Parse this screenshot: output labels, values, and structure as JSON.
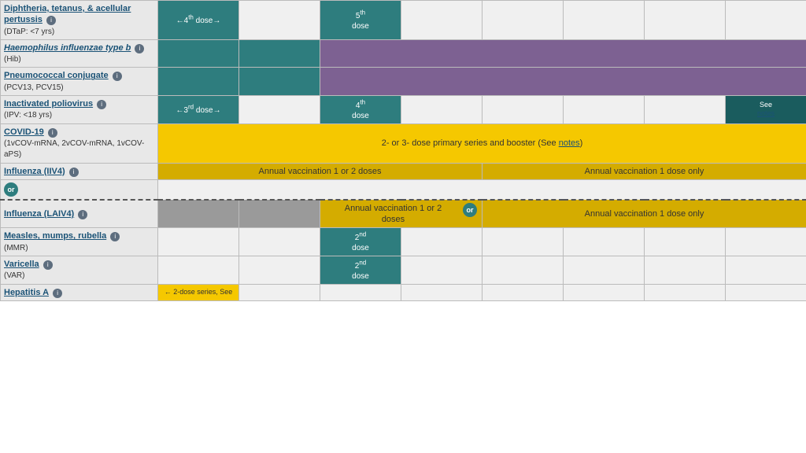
{
  "vaccines": [
    {
      "id": "dtap",
      "name": "Diphtheria, tetanus, & acellular pertussis",
      "italic": false,
      "subLabel": "(DTaP: <7 yrs)",
      "hasInfo": true,
      "row": [
        {
          "colspan": 1,
          "class": "teal-dark",
          "text": "←4th dose→",
          "sup": ""
        },
        {
          "colspan": 1,
          "class": "empty-cell",
          "text": ""
        },
        {
          "colspan": 1,
          "class": "teal-dark",
          "text": "5th\ndose",
          "sup": ""
        },
        {
          "colspan": 1,
          "class": "empty-cell",
          "text": ""
        },
        {
          "colspan": 1,
          "class": "empty-cell",
          "text": ""
        },
        {
          "colspan": 1,
          "class": "empty-cell",
          "text": ""
        },
        {
          "colspan": 1,
          "class": "empty-cell",
          "text": ""
        },
        {
          "colspan": 1,
          "class": "empty-cell",
          "text": ""
        }
      ]
    },
    {
      "id": "hib",
      "name": "Haemophilus influenzae type b",
      "italic": true,
      "subLabel": "(Hib)",
      "hasInfo": true,
      "row": [
        {
          "colspan": 1,
          "class": "teal-dark",
          "text": ""
        },
        {
          "colspan": 1,
          "class": "teal-dark",
          "text": ""
        },
        {
          "colspan": 6,
          "class": "purple",
          "text": ""
        }
      ]
    },
    {
      "id": "pcv",
      "name": "Pneumococcal conjugate",
      "italic": false,
      "subLabel": "(PCV13, PCV15)",
      "hasInfo": true,
      "row": [
        {
          "colspan": 1,
          "class": "teal-dark",
          "text": ""
        },
        {
          "colspan": 1,
          "class": "teal-dark",
          "text": ""
        },
        {
          "colspan": 6,
          "class": "purple",
          "text": ""
        }
      ]
    },
    {
      "id": "ipv",
      "name": "Inactivated poliovirus",
      "italic": false,
      "subLabel": "(IPV: <18 yrs)",
      "hasInfo": true,
      "row": [
        {
          "colspan": 1,
          "class": "teal-dark",
          "text": "←3rd dose→"
        },
        {
          "colspan": 1,
          "class": "empty-cell",
          "text": ""
        },
        {
          "colspan": 1,
          "class": "teal-dark",
          "text": "4th\ndose"
        },
        {
          "colspan": 1,
          "class": "empty-cell",
          "text": ""
        },
        {
          "colspan": 1,
          "class": "empty-cell",
          "text": ""
        },
        {
          "colspan": 1,
          "class": "empty-cell",
          "text": ""
        },
        {
          "colspan": 1,
          "class": "empty-cell",
          "text": ""
        },
        {
          "colspan": 1,
          "class": "dark-teal",
          "text": "See\nnotes",
          "link": true
        }
      ]
    },
    {
      "id": "covid",
      "name": "COVID-19",
      "italic": false,
      "subLabel": "(1vCOV-mRNA, 2vCOV-mRNA, 1vCOV-aPS)",
      "hasInfo": true,
      "row": [
        {
          "colspan": 8,
          "class": "yellow",
          "text": "2- or 3- dose primary series and booster (See notes)",
          "hasNotesLink": true
        }
      ]
    },
    {
      "id": "influenza-iiv4",
      "name": "Influenza (IIV4)",
      "italic": false,
      "subLabel": "",
      "hasInfo": true,
      "row": [
        {
          "colspan": 4,
          "class": "yellow-dark",
          "text": "Annual vaccination 1 or 2 doses"
        },
        {
          "colspan": 4,
          "class": "yellow-dark",
          "text": "Annual vaccination 1 dose only"
        }
      ]
    },
    {
      "id": "or-row",
      "isOrRow": true
    },
    {
      "id": "influenza-laiv4",
      "name": "Influenza (LAIV4)",
      "italic": false,
      "subLabel": "",
      "hasInfo": true,
      "isDashed": true,
      "row": [
        {
          "colspan": 1,
          "class": "gray-cell",
          "text": ""
        },
        {
          "colspan": 1,
          "class": "gray-cell",
          "text": ""
        },
        {
          "colspan": 2,
          "class": "yellow-dark",
          "text": "Annual vaccination 1 or 2 doses",
          "hasOrBadge": true
        },
        {
          "colspan": 4,
          "class": "yellow-dark",
          "text": "Annual vaccination 1 dose only"
        }
      ]
    },
    {
      "id": "mmr",
      "name": "Measles, mumps, rubella",
      "italic": false,
      "subLabel": "(MMR)",
      "hasInfo": true,
      "row": [
        {
          "colspan": 1,
          "class": "empty-cell",
          "text": ""
        },
        {
          "colspan": 1,
          "class": "empty-cell",
          "text": ""
        },
        {
          "colspan": 1,
          "class": "teal-dark",
          "text": "2nd\ndose"
        },
        {
          "colspan": 1,
          "class": "empty-cell",
          "text": ""
        },
        {
          "colspan": 1,
          "class": "empty-cell",
          "text": ""
        },
        {
          "colspan": 1,
          "class": "empty-cell",
          "text": ""
        },
        {
          "colspan": 1,
          "class": "empty-cell",
          "text": ""
        },
        {
          "colspan": 1,
          "class": "empty-cell",
          "text": ""
        }
      ]
    },
    {
      "id": "varicella",
      "name": "Varicella",
      "italic": false,
      "subLabel": "(VAR)",
      "hasInfo": true,
      "row": [
        {
          "colspan": 1,
          "class": "empty-cell",
          "text": ""
        },
        {
          "colspan": 1,
          "class": "empty-cell",
          "text": ""
        },
        {
          "colspan": 1,
          "class": "teal-dark",
          "text": "2nd\ndose"
        },
        {
          "colspan": 1,
          "class": "empty-cell",
          "text": ""
        },
        {
          "colspan": 1,
          "class": "empty-cell",
          "text": ""
        },
        {
          "colspan": 1,
          "class": "empty-cell",
          "text": ""
        },
        {
          "colspan": 1,
          "class": "empty-cell",
          "text": ""
        },
        {
          "colspan": 1,
          "class": "empty-cell",
          "text": ""
        }
      ]
    },
    {
      "id": "hepa",
      "name": "Hepatitis A",
      "italic": false,
      "subLabel": "",
      "hasInfo": true,
      "row": [
        {
          "colspan": 1,
          "class": "yellow",
          "text": "← 2-dose series, See"
        },
        {
          "colspan": 7,
          "class": "empty-cell",
          "text": ""
        }
      ]
    }
  ],
  "labels": {
    "orText": "or",
    "seeNotesText": "notes",
    "covidNotesText": "notes",
    "dose4th": "4th\ndose",
    "dose5th": "5th\ndose",
    "dose2nd": "2nd\ndose",
    "arrowLeft3rd": "←3rd dose→",
    "arrowLeft4th": "←4th dose→",
    "annualVacc12": "Annual vaccination 1 or 2 doses",
    "annualVacc1": "Annual vaccination 1 dose only",
    "annualVacc12b": "Annual vaccination 1 or 2\ndoses",
    "covid19Series": "2- or 3- dose primary series and booster (See ",
    "hepA": "← 2-dose series, See"
  }
}
